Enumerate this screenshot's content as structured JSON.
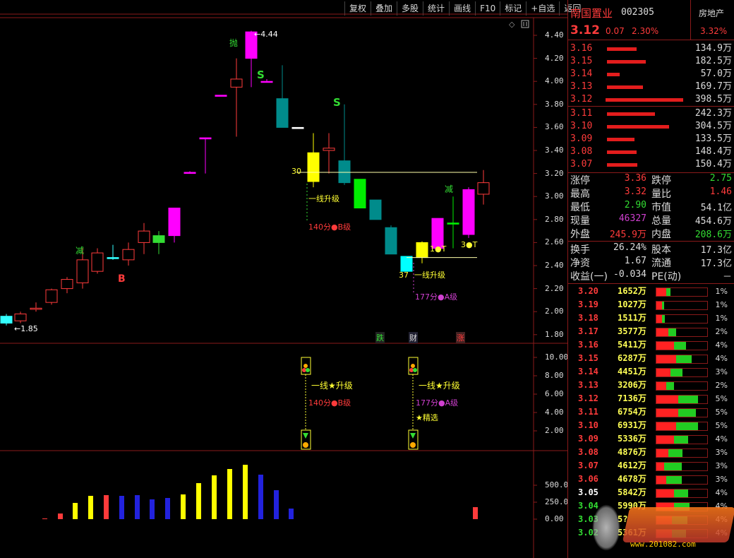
{
  "toolbar": {
    "items": [
      "复权",
      "叠加",
      "多股",
      "统计",
      "画线",
      "F10",
      "标记",
      "+自选",
      "返回"
    ]
  },
  "stock": {
    "name": "南国置业",
    "code": "002305",
    "sector": "房地产",
    "price": "3.12",
    "change": "0.07",
    "pct": "2.30%",
    "sector_pct": "3.32%"
  },
  "asks": [
    {
      "price": "3.16",
      "vol": "134.9万",
      "bar": 0.38
    },
    {
      "price": "3.15",
      "vol": "182.5万",
      "bar": 0.5
    },
    {
      "price": "3.14",
      "vol": "57.0万",
      "bar": 0.16
    },
    {
      "price": "3.13",
      "vol": "169.7万",
      "bar": 0.46
    },
    {
      "price": "3.12",
      "vol": "398.5万",
      "bar": 1.0
    }
  ],
  "bids": [
    {
      "price": "3.11",
      "vol": "242.3万",
      "bar": 0.62
    },
    {
      "price": "3.10",
      "vol": "304.5万",
      "bar": 0.8
    },
    {
      "price": "3.09",
      "vol": "133.5万",
      "bar": 0.35
    },
    {
      "price": "3.08",
      "vol": "148.4万",
      "bar": 0.38
    },
    {
      "price": "3.07",
      "vol": "150.4万",
      "bar": 0.39
    }
  ],
  "stats": [
    {
      "l1": "涨停",
      "v1": "3.36",
      "c1": "#ff3b3b",
      "l2": "跌停",
      "v2": "2.75",
      "c2": "#33dd33"
    },
    {
      "l1": "最高",
      "v1": "3.32",
      "c1": "#ff3b3b",
      "l2": "量比",
      "v2": "1.46",
      "c2": "#ff3b3b"
    },
    {
      "l1": "最低",
      "v1": "2.90",
      "c1": "#33dd33",
      "l2": "市值",
      "v2": "54.1亿",
      "c2": "#ddd"
    },
    {
      "l1": "现量",
      "v1": "46327",
      "c1": "#d040d0",
      "l2": "总量",
      "v2": "454.6万",
      "c2": "#ddd"
    },
    {
      "l1": "外盘",
      "v1": "245.9万",
      "c1": "#ff3b3b",
      "l2": "内盘",
      "v2": "208.6万",
      "c2": "#33dd33"
    },
    {
      "l1": "换手",
      "v1": "26.24%",
      "c1": "#ddd",
      "l2": "股本",
      "v2": "17.3亿",
      "c2": "#ddd"
    },
    {
      "l1": "净资",
      "v1": "1.67",
      "c1": "#ddd",
      "l2": "流通",
      "v2": "17.3亿",
      "c2": "#ddd"
    },
    {
      "l1": "收益(一)",
      "v1": "-0.034",
      "c1": "#ddd",
      "l2": "PE(动)",
      "v2": "－",
      "c2": "#ddd"
    }
  ],
  "price_dist": [
    {
      "p": "3.20",
      "v": "1652万",
      "pct": "1%",
      "c": "#ff3b3b",
      "r": 0.5,
      "g": 0.2
    },
    {
      "p": "3.19",
      "v": "1027万",
      "pct": "1%",
      "c": "#ff3b3b",
      "r": 0.3,
      "g": 0.1
    },
    {
      "p": "3.18",
      "v": "1511万",
      "pct": "1%",
      "c": "#ff3b3b",
      "r": 0.3,
      "g": 0.15
    },
    {
      "p": "3.17",
      "v": "3577万",
      "pct": "2%",
      "c": "#ff3b3b",
      "r": 0.6,
      "g": 0.4
    },
    {
      "p": "3.16",
      "v": "5411万",
      "pct": "4%",
      "c": "#ff3b3b",
      "r": 0.9,
      "g": 0.6
    },
    {
      "p": "3.15",
      "v": "6287万",
      "pct": "4%",
      "c": "#ff3b3b",
      "r": 1.0,
      "g": 0.8
    },
    {
      "p": "3.14",
      "v": "4451万",
      "pct": "3%",
      "c": "#ff3b3b",
      "r": 0.7,
      "g": 0.6
    },
    {
      "p": "3.13",
      "v": "3206万",
      "pct": "2%",
      "c": "#ff3b3b",
      "r": 0.5,
      "g": 0.4
    },
    {
      "p": "3.12",
      "v": "7136万",
      "pct": "5%",
      "c": "#ff3b3b",
      "r": 1.1,
      "g": 1.0
    },
    {
      "p": "3.11",
      "v": "6754万",
      "pct": "5%",
      "c": "#ff3b3b",
      "r": 1.1,
      "g": 0.9
    },
    {
      "p": "3.10",
      "v": "6931万",
      "pct": "5%",
      "c": "#ff3b3b",
      "r": 1.0,
      "g": 1.1
    },
    {
      "p": "3.09",
      "v": "5336万",
      "pct": "4%",
      "c": "#ff3b3b",
      "r": 0.9,
      "g": 0.7
    },
    {
      "p": "3.08",
      "v": "4876万",
      "pct": "3%",
      "c": "#ff3b3b",
      "r": 0.6,
      "g": 0.7
    },
    {
      "p": "3.07",
      "v": "4612万",
      "pct": "3%",
      "c": "#ff3b3b",
      "r": 0.4,
      "g": 0.9
    },
    {
      "p": "3.06",
      "v": "4678万",
      "pct": "3%",
      "c": "#ff3b3b",
      "r": 0.5,
      "g": 0.8
    },
    {
      "p": "3.05",
      "v": "5842万",
      "pct": "4%",
      "c": "#ffffff",
      "r": 0.9,
      "g": 0.7
    },
    {
      "p": "3.04",
      "v": "5990万",
      "pct": "4%",
      "c": "#33dd33",
      "r": 0.9,
      "g": 0.8
    },
    {
      "p": "3.03",
      "v": "5?",
      "pct": "4%",
      "c": "#33dd33",
      "r": 0.8,
      "g": 0.8
    },
    {
      "p": "3.02",
      "v": "5361万",
      "pct": "4%",
      "c": "#33dd33",
      "r": 0.8,
      "g": 0.7
    }
  ],
  "chart_axes": {
    "price_ticks": [
      "4.40",
      "4.20",
      "4.00",
      "3.80",
      "3.60",
      "3.40",
      "3.20",
      "3.00",
      "2.80",
      "2.60",
      "2.40",
      "2.20",
      "2.00",
      "1.80"
    ],
    "ind_ticks": [
      "10.00",
      "8.00",
      "6.00",
      "4.00",
      "2.00"
    ],
    "vol_ticks": [
      "500.0",
      "250.0",
      "0.00"
    ]
  },
  "annotations": {
    "high": "4.44",
    "low": "1.85",
    "sig_jian": "减",
    "sig_B": "B",
    "sig_pao": "抛",
    "sig_S": "S",
    "num30": "30",
    "num37": "37",
    "one_line_up": "一线升级",
    "m140": "140分●B级",
    "m177": "177分●A级",
    "oneT": "1●T",
    "threeT": "3●T",
    "die": "跌",
    "cai": "财",
    "zhang": "涨",
    "ind_up": "一线★升级",
    "jingxuan": "★精选"
  },
  "watermark": {
    "site": "www.201082.com"
  }
}
